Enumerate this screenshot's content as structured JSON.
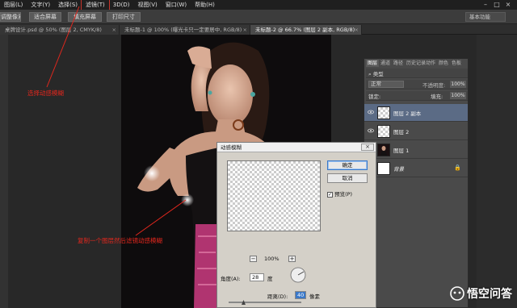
{
  "menu": {
    "items": [
      "图层(L)",
      "文字(Y)",
      "选择(S)",
      "滤镜(T)",
      "3D(D)",
      "视图(V)",
      "窗口(W)",
      "帮助(H)"
    ],
    "active_index": 3,
    "window_controls": [
      "–",
      "□",
      "×"
    ]
  },
  "options": {
    "buttons": [
      "调整像素",
      "适合屏幕",
      "填充屏幕",
      "打印尺寸"
    ],
    "workspace": "基本功能"
  },
  "tabs": [
    {
      "label": "桌牌设计.psd @ 50% (图层 2, CMYK/8)",
      "active": false
    },
    {
      "label": "未标题-1 @ 100% (曝光卡只一定要居中, RGB/8)",
      "active": false
    },
    {
      "label": "未标题-2 @ 66.7% (图层 2 副本, RGB/8)",
      "active": true
    }
  ],
  "layers_panel": {
    "tabs": [
      "图层",
      "通道",
      "路径",
      "历史记录",
      "动作",
      "颜色",
      "色板"
    ],
    "active_tab": 0,
    "filter_label": "类型",
    "blend_mode": "正常",
    "opacity_label": "不透明度:",
    "opacity_value": "100%",
    "lock_label": "锁定:",
    "fill_label": "填充:",
    "fill_value": "100%",
    "layers": [
      {
        "name": "图层 2 副本",
        "selected": true,
        "thumb": "checker"
      },
      {
        "name": "图层 2",
        "selected": false,
        "thumb": "checker"
      },
      {
        "name": "图层 1",
        "selected": false,
        "thumb": "photo"
      },
      {
        "name": "背景",
        "selected": false,
        "thumb": "white",
        "locked": true
      }
    ]
  },
  "dialog": {
    "title": "动感模糊",
    "close": "×",
    "ok": "确定",
    "cancel": "取消",
    "preview_label": "预览(P)",
    "preview_checked": true,
    "zoom_out": "−",
    "zoom_in": "+",
    "zoom_value": "100%",
    "angle_label": "角度(A):",
    "angle_value": "28",
    "angle_unit": "度",
    "distance_label": "距离(D):",
    "distance_value": "40",
    "distance_unit": "像素"
  },
  "annotations": {
    "select_motion_blur": "选择动感模糊",
    "copy_layer_hint": "复制一个图层然后滤镜动感模糊"
  },
  "watermark": "悟空问答",
  "colors": {
    "annotation_red": "#e3271d",
    "selected_layer": "#5b6b85",
    "dialog_bg": "#d4d0c8"
  }
}
